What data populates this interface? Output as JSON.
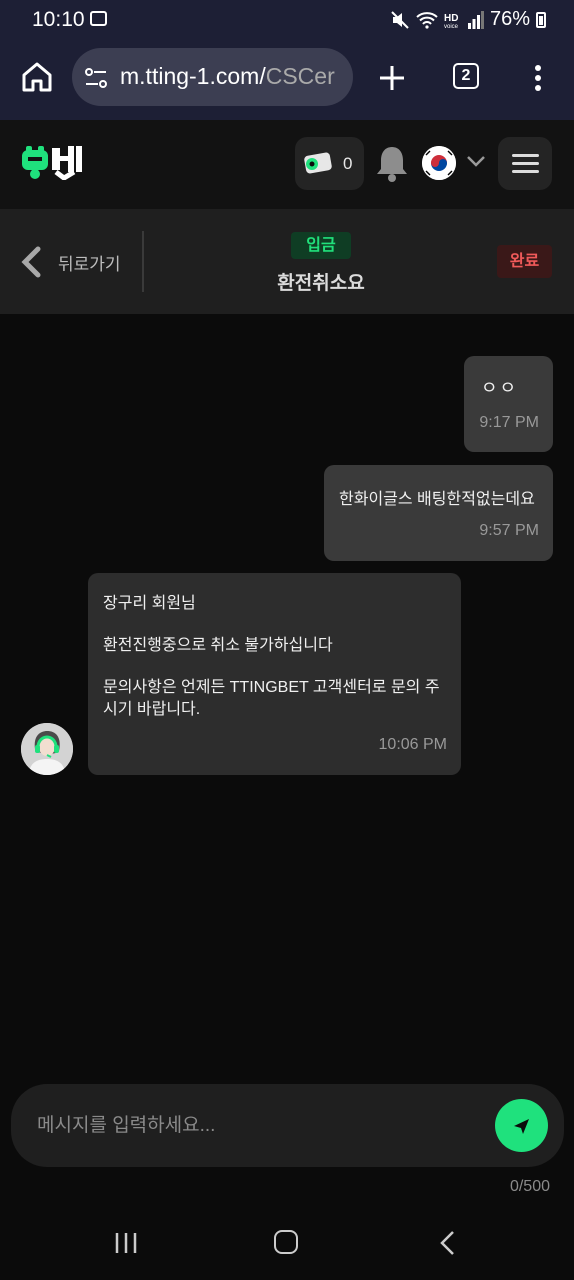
{
  "status_bar": {
    "time": "10:10",
    "battery": "76%"
  },
  "browser": {
    "url_host": "m.tting-1.com/",
    "url_path": "CSCer",
    "tab_count": "2"
  },
  "header": {
    "wallet_count": "0"
  },
  "ticket": {
    "back_label": "뒤로가기",
    "type_tag": "입금",
    "subject": "환전취소요",
    "status_tag": "완료"
  },
  "messages": [
    {
      "side": "user",
      "text": "ㅇㅇ",
      "time": "9:17 PM"
    },
    {
      "side": "user",
      "text": "한화이글스 배팅한적없는데요",
      "time": "9:57 PM"
    },
    {
      "side": "agent",
      "lines": [
        "장구리 회원님",
        "환전진행중으로 취소 불가하십니다",
        "문의사항은 언제든 TTINGBET 고객센터로 문의 주시기 바랍니다."
      ],
      "time": "10:06 PM"
    }
  ],
  "composer": {
    "placeholder": "메시지를 입력하세요...",
    "counter": "0/500"
  },
  "colors": {
    "accent": "#1fe17d",
    "status_bar_bg": "#1d1f35",
    "done_red": "#ef5a5a"
  }
}
